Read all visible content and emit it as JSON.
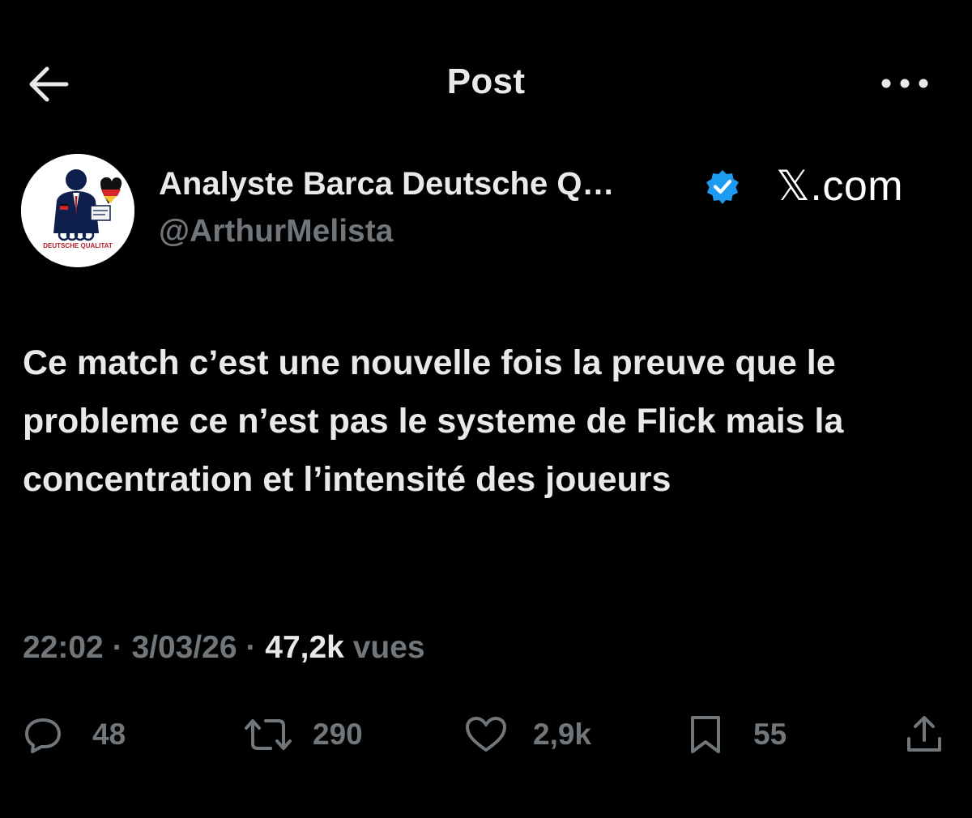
{
  "header": {
    "title": "Post"
  },
  "author": {
    "display_name": "Analyste Barca Deutsche Q…",
    "handle": "@ArthurMelista",
    "avatar_caption": "DEUTSCHE QUALITAT",
    "verified": true,
    "verified_color": "#1d9bf0"
  },
  "watermark": {
    "text": "𝕏.com"
  },
  "post": {
    "text": "Ce match c’est une nouvelle fois la preuve que le probleme ce n’est pas le systeme de Flick mais la concentration et l’intensité des joueurs"
  },
  "meta": {
    "time": "22:02",
    "date": "3/03/26",
    "views": "47,2k",
    "views_label": "vues",
    "separator": "·"
  },
  "actions": {
    "replies": "48",
    "reposts": "290",
    "likes": "2,9k",
    "bookmarks": "55"
  },
  "icons": {
    "back": "arrow-left-icon",
    "more": "more-horizontal-icon",
    "verified": "verified-badge-icon",
    "reply": "reply-icon",
    "repost": "repost-icon",
    "like": "heart-icon",
    "bookmark": "bookmark-icon",
    "share": "share-icon"
  },
  "colors": {
    "background": "#000000",
    "text_primary": "#e7e9ea",
    "text_secondary": "#71767b",
    "accent": "#1d9bf0"
  }
}
